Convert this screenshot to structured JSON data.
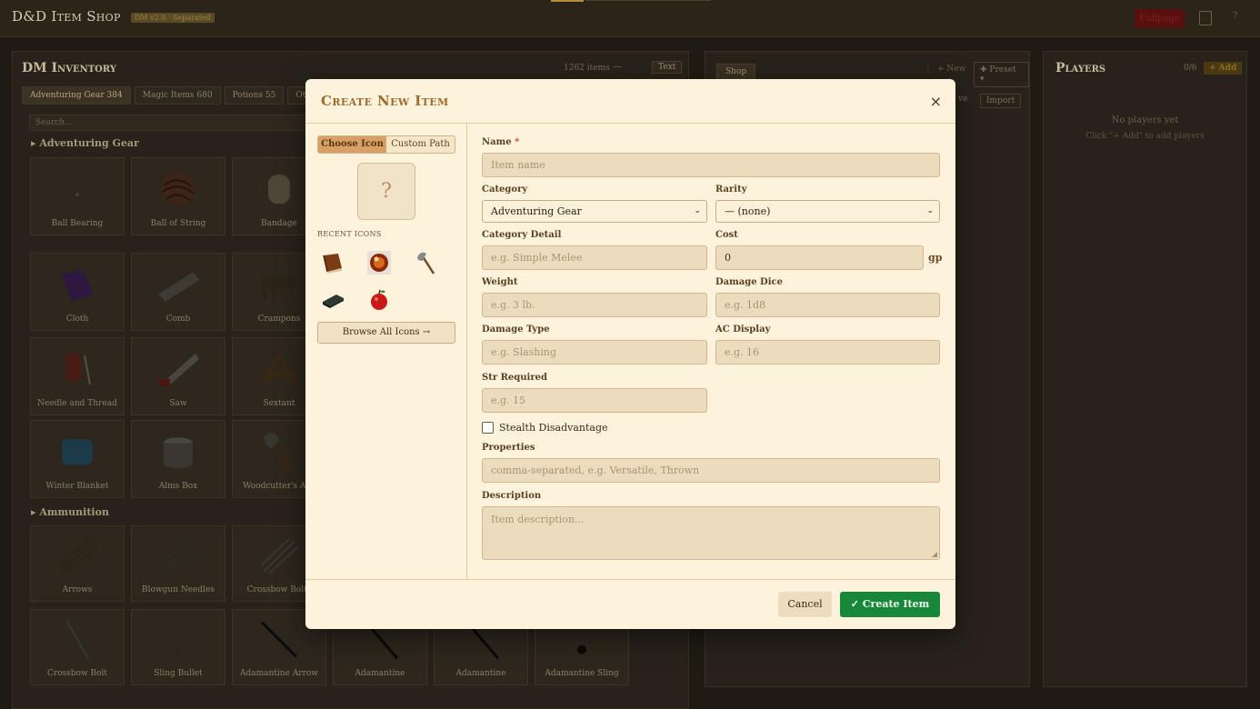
{
  "app": {
    "title": "D&D Item Shop",
    "version": "DM v2.0 · Separated",
    "top_red_label": "Fullpage",
    "help_label": "?"
  },
  "inventory": {
    "title": "DM Inventory",
    "count": "1262 items",
    "minus": "—",
    "text_button": "Text",
    "tabs": [
      {
        "label": "Adventuring Gear",
        "count": "384"
      },
      {
        "label": "Magic Items",
        "count": "680"
      },
      {
        "label": "Potions",
        "count": "55"
      },
      {
        "label": "Other",
        "count": ""
      }
    ],
    "search_placeholder": "Search...",
    "sections": [
      {
        "title": "Adventuring Gear"
      },
      {
        "title": "Ammunition"
      }
    ],
    "items": [
      "Ball Bearing",
      "Ball of String",
      "Bandage",
      "Cloth",
      "Comb",
      "Crampons",
      "Needle and Thread",
      "Saw",
      "Sextant",
      "Winter Blanket",
      "Alms Box",
      "Woodcutter's Axe",
      "Arrows",
      "Blowgun Needles",
      "Crossbow Bolts",
      "Crossbow Bolt",
      "Sling Bullet",
      "Adamantine Arrow",
      "Adamantine",
      "Adamantine",
      "Adamantine Sling"
    ]
  },
  "shop": {
    "tab": "Shop",
    "dots": "⋮",
    "new": "+ New",
    "preset": "✚ Preset ▾",
    "save_partial": "ve",
    "import": "Import"
  },
  "players": {
    "title": "Players",
    "count": "0/6",
    "add": "+ Add",
    "empty": "No players yet",
    "hint": "Click \"+ Add\" to add players"
  },
  "modal": {
    "title": "Create New Item",
    "close": "×",
    "icon_tabs": {
      "choose": "Choose Icon",
      "custom": "Custom Path"
    },
    "preview_glyph": "?",
    "recent_label": "RECENT ICONS",
    "recent_icons": [
      "book-icon",
      "orb-icon",
      "axe-icon",
      "whetstone-icon",
      "apple-icon"
    ],
    "browse": "Browse All Icons →",
    "fields": {
      "name": {
        "label": "Name",
        "required": "*",
        "placeholder": "Item name"
      },
      "category": {
        "label": "Category",
        "value": "Adventuring Gear"
      },
      "rarity": {
        "label": "Rarity",
        "value": "— (none)"
      },
      "category_detail": {
        "label": "Category Detail",
        "placeholder": "e.g. Simple Melee"
      },
      "cost": {
        "label": "Cost",
        "value": "0",
        "unit": "gp"
      },
      "weight": {
        "label": "Weight",
        "placeholder": "e.g. 3 lb."
      },
      "damage_dice": {
        "label": "Damage Dice",
        "placeholder": "e.g. 1d8"
      },
      "damage_type": {
        "label": "Damage Type",
        "placeholder": "e.g. Slashing"
      },
      "ac_display": {
        "label": "AC Display",
        "placeholder": "e.g. 16"
      },
      "str_required": {
        "label": "Str Required",
        "placeholder": "e.g. 15"
      },
      "stealth": {
        "label": "Stealth Disadvantage",
        "checked": false
      },
      "properties": {
        "label": "Properties",
        "placeholder": "comma-separated, e.g. Versatile, Thrown"
      },
      "description": {
        "label": "Description",
        "placeholder": "Item description..."
      }
    },
    "cancel": "Cancel",
    "create": "✓ Create Item"
  },
  "colors": {
    "accent": "#a06a2a",
    "create_green": "#17873a",
    "toggle_active": "#d8a066",
    "backdrop": "#1f1b14"
  }
}
